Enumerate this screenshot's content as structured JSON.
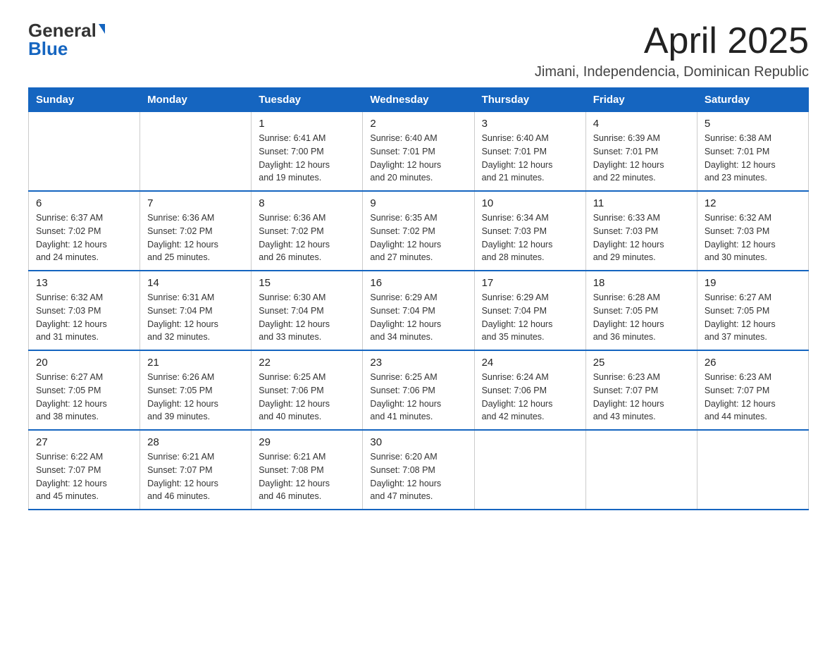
{
  "logo": {
    "general": "General",
    "blue": "Blue"
  },
  "title": {
    "month_year": "April 2025",
    "location": "Jimani, Independencia, Dominican Republic"
  },
  "headers": [
    "Sunday",
    "Monday",
    "Tuesday",
    "Wednesday",
    "Thursday",
    "Friday",
    "Saturday"
  ],
  "weeks": [
    [
      {
        "day": "",
        "info": ""
      },
      {
        "day": "",
        "info": ""
      },
      {
        "day": "1",
        "info": "Sunrise: 6:41 AM\nSunset: 7:00 PM\nDaylight: 12 hours\nand 19 minutes."
      },
      {
        "day": "2",
        "info": "Sunrise: 6:40 AM\nSunset: 7:01 PM\nDaylight: 12 hours\nand 20 minutes."
      },
      {
        "day": "3",
        "info": "Sunrise: 6:40 AM\nSunset: 7:01 PM\nDaylight: 12 hours\nand 21 minutes."
      },
      {
        "day": "4",
        "info": "Sunrise: 6:39 AM\nSunset: 7:01 PM\nDaylight: 12 hours\nand 22 minutes."
      },
      {
        "day": "5",
        "info": "Sunrise: 6:38 AM\nSunset: 7:01 PM\nDaylight: 12 hours\nand 23 minutes."
      }
    ],
    [
      {
        "day": "6",
        "info": "Sunrise: 6:37 AM\nSunset: 7:02 PM\nDaylight: 12 hours\nand 24 minutes."
      },
      {
        "day": "7",
        "info": "Sunrise: 6:36 AM\nSunset: 7:02 PM\nDaylight: 12 hours\nand 25 minutes."
      },
      {
        "day": "8",
        "info": "Sunrise: 6:36 AM\nSunset: 7:02 PM\nDaylight: 12 hours\nand 26 minutes."
      },
      {
        "day": "9",
        "info": "Sunrise: 6:35 AM\nSunset: 7:02 PM\nDaylight: 12 hours\nand 27 minutes."
      },
      {
        "day": "10",
        "info": "Sunrise: 6:34 AM\nSunset: 7:03 PM\nDaylight: 12 hours\nand 28 minutes."
      },
      {
        "day": "11",
        "info": "Sunrise: 6:33 AM\nSunset: 7:03 PM\nDaylight: 12 hours\nand 29 minutes."
      },
      {
        "day": "12",
        "info": "Sunrise: 6:32 AM\nSunset: 7:03 PM\nDaylight: 12 hours\nand 30 minutes."
      }
    ],
    [
      {
        "day": "13",
        "info": "Sunrise: 6:32 AM\nSunset: 7:03 PM\nDaylight: 12 hours\nand 31 minutes."
      },
      {
        "day": "14",
        "info": "Sunrise: 6:31 AM\nSunset: 7:04 PM\nDaylight: 12 hours\nand 32 minutes."
      },
      {
        "day": "15",
        "info": "Sunrise: 6:30 AM\nSunset: 7:04 PM\nDaylight: 12 hours\nand 33 minutes."
      },
      {
        "day": "16",
        "info": "Sunrise: 6:29 AM\nSunset: 7:04 PM\nDaylight: 12 hours\nand 34 minutes."
      },
      {
        "day": "17",
        "info": "Sunrise: 6:29 AM\nSunset: 7:04 PM\nDaylight: 12 hours\nand 35 minutes."
      },
      {
        "day": "18",
        "info": "Sunrise: 6:28 AM\nSunset: 7:05 PM\nDaylight: 12 hours\nand 36 minutes."
      },
      {
        "day": "19",
        "info": "Sunrise: 6:27 AM\nSunset: 7:05 PM\nDaylight: 12 hours\nand 37 minutes."
      }
    ],
    [
      {
        "day": "20",
        "info": "Sunrise: 6:27 AM\nSunset: 7:05 PM\nDaylight: 12 hours\nand 38 minutes."
      },
      {
        "day": "21",
        "info": "Sunrise: 6:26 AM\nSunset: 7:05 PM\nDaylight: 12 hours\nand 39 minutes."
      },
      {
        "day": "22",
        "info": "Sunrise: 6:25 AM\nSunset: 7:06 PM\nDaylight: 12 hours\nand 40 minutes."
      },
      {
        "day": "23",
        "info": "Sunrise: 6:25 AM\nSunset: 7:06 PM\nDaylight: 12 hours\nand 41 minutes."
      },
      {
        "day": "24",
        "info": "Sunrise: 6:24 AM\nSunset: 7:06 PM\nDaylight: 12 hours\nand 42 minutes."
      },
      {
        "day": "25",
        "info": "Sunrise: 6:23 AM\nSunset: 7:07 PM\nDaylight: 12 hours\nand 43 minutes."
      },
      {
        "day": "26",
        "info": "Sunrise: 6:23 AM\nSunset: 7:07 PM\nDaylight: 12 hours\nand 44 minutes."
      }
    ],
    [
      {
        "day": "27",
        "info": "Sunrise: 6:22 AM\nSunset: 7:07 PM\nDaylight: 12 hours\nand 45 minutes."
      },
      {
        "day": "28",
        "info": "Sunrise: 6:21 AM\nSunset: 7:07 PM\nDaylight: 12 hours\nand 46 minutes."
      },
      {
        "day": "29",
        "info": "Sunrise: 6:21 AM\nSunset: 7:08 PM\nDaylight: 12 hours\nand 46 minutes."
      },
      {
        "day": "30",
        "info": "Sunrise: 6:20 AM\nSunset: 7:08 PM\nDaylight: 12 hours\nand 47 minutes."
      },
      {
        "day": "",
        "info": ""
      },
      {
        "day": "",
        "info": ""
      },
      {
        "day": "",
        "info": ""
      }
    ]
  ]
}
